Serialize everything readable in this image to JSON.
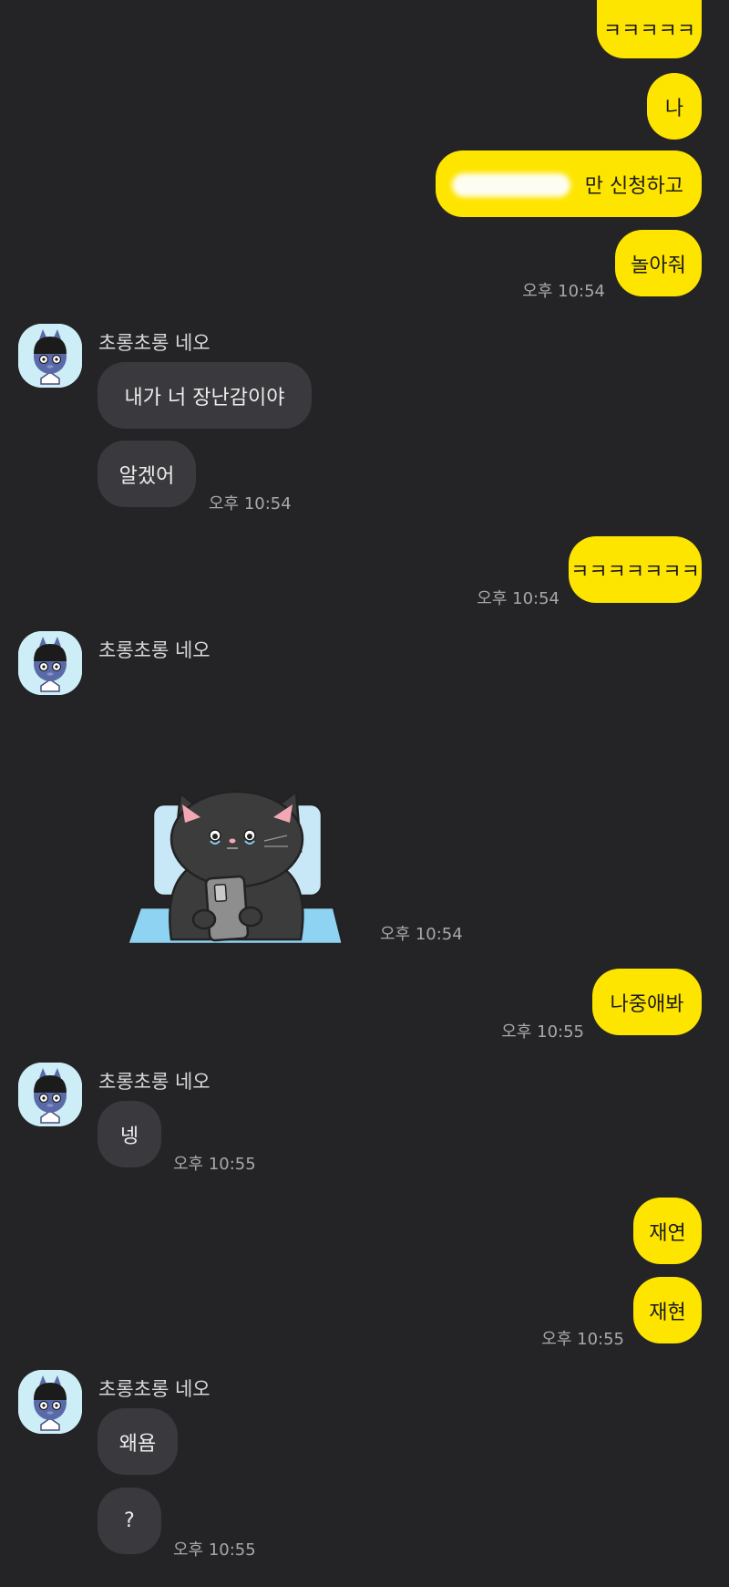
{
  "chat": {
    "sender_name": "초롱초롱 네오",
    "messages": [
      {
        "dir": "out",
        "text": "ㅋㅋㅋㅋㅋ"
      },
      {
        "dir": "out",
        "text": "나"
      },
      {
        "dir": "out",
        "text": "만 신청하고"
      },
      {
        "dir": "out",
        "text": "놀아줘",
        "time": "오후 10:54"
      },
      {
        "dir": "in",
        "text": "내가 너 장난감이야"
      },
      {
        "dir": "in",
        "text": "알겠어",
        "time": "오후 10:54"
      },
      {
        "dir": "out",
        "text": "ㅋㅋㅋㅋㅋㅋㅋ",
        "time": "오후 10:54"
      },
      {
        "dir": "in",
        "type": "sticker",
        "time": "오후 10:54"
      },
      {
        "dir": "out",
        "text": "나중애봐",
        "time": "오후 10:55"
      },
      {
        "dir": "in",
        "text": "넹",
        "time": "오후 10:55"
      },
      {
        "dir": "out",
        "text": "재연"
      },
      {
        "dir": "out",
        "text": "재현",
        "time": "오후 10:55"
      },
      {
        "dir": "in",
        "text": "왜욤"
      },
      {
        "dir": "in",
        "text": "?",
        "time": "오후 10:55"
      }
    ]
  },
  "colors": {
    "background": "#242427",
    "outgoing_bubble": "#fee500",
    "incoming_bubble": "#3a3a3e",
    "timestamp": "#a8a8a8"
  },
  "icons": {
    "avatar": "neo-character-avatar-icon",
    "sticker": "black-cat-on-phone-sticker"
  }
}
